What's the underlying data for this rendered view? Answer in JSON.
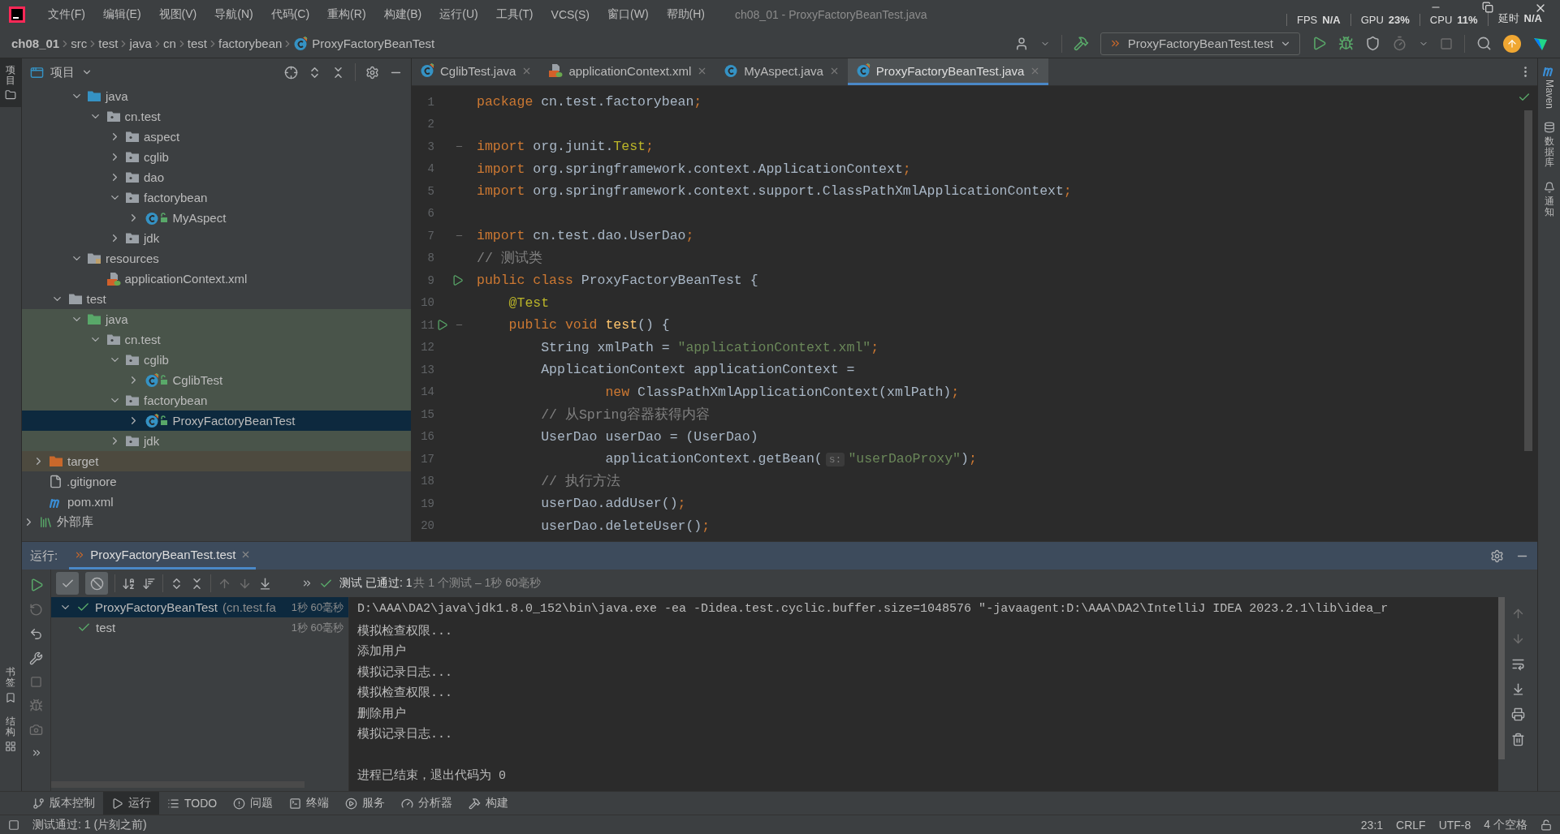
{
  "window": {
    "title": "ch08_01 - ProxyFactoryBeanTest.java"
  },
  "menu": [
    "文件(F)",
    "编辑(E)",
    "视图(V)",
    "导航(N)",
    "代码(C)",
    "重构(R)",
    "构建(B)",
    "运行(U)",
    "工具(T)",
    "VCS(S)",
    "窗口(W)",
    "帮助(H)"
  ],
  "monitor": [
    {
      "label": "FPS",
      "value": "N/A"
    },
    {
      "label": "GPU",
      "value": "23%"
    },
    {
      "label": "CPU",
      "value": "11%"
    },
    {
      "label": "延时",
      "value": "N/A"
    }
  ],
  "breadcrumbs": [
    {
      "label": "ch08_01",
      "kind": "project"
    },
    {
      "label": "src",
      "kind": "folder"
    },
    {
      "label": "test",
      "kind": "folder"
    },
    {
      "label": "java",
      "kind": "folder"
    },
    {
      "label": "cn",
      "kind": "folder"
    },
    {
      "label": "test",
      "kind": "folder"
    },
    {
      "label": "factorybean",
      "kind": "folder"
    },
    {
      "label": "ProxyFactoryBeanTest",
      "kind": "class"
    }
  ],
  "run_config": "ProxyFactoryBeanTest.test",
  "side_left": {
    "top": [
      {
        "label": "项目",
        "selected": true
      }
    ],
    "bottom": [
      {
        "label": "书签",
        "kind": "bookmarks"
      },
      {
        "label": "结构",
        "kind": "structure"
      }
    ]
  },
  "side_right": [
    {
      "label": "Maven",
      "kind": "maven"
    },
    {
      "label": "数据库",
      "kind": "database"
    },
    {
      "label": "通知",
      "kind": "notifications"
    }
  ],
  "project_panel": {
    "title": "项目",
    "tree": [
      {
        "children": [
          {
            "children": [
              {
                "children": [
                  {
                    "label": "java",
                    "kind": "source-root",
                    "expanded": true,
                    "selected": false,
                    "children": [
                      {
                        "label": "cn.test",
                        "kind": "package",
                        "expanded": true,
                        "selected": false,
                        "children": [
                          {
                            "label": "aspect",
                            "kind": "package",
                            "expanded": false,
                            "selected": false
                          },
                          {
                            "label": "cglib",
                            "kind": "package",
                            "expanded": false,
                            "selected": false
                          },
                          {
                            "label": "dao",
                            "kind": "package",
                            "expanded": false,
                            "selected": false
                          },
                          {
                            "label": "factorybean",
                            "kind": "package",
                            "expanded": true,
                            "selected": false,
                            "children": [
                              {
                                "label": "MyAspect",
                                "kind": "class",
                                "expanded": false,
                                "selected": false
                              }
                            ]
                          },
                          {
                            "label": "jdk",
                            "kind": "package",
                            "expanded": false,
                            "selected": false
                          }
                        ]
                      }
                    ]
                  },
                  {
                    "label": "resources",
                    "kind": "resources",
                    "expanded": true,
                    "selected": false,
                    "children": [
                      {
                        "label": "applicationContext.xml",
                        "kind": "xml",
                        "selected": false
                      }
                    ]
                  }
                ]
              },
              {
                "label": "test",
                "kind": "folder",
                "expanded": true,
                "selected": false,
                "children": [
                  {
                    "label": "java",
                    "kind": "test-root",
                    "expanded": true,
                    "selected": false,
                    "children": [
                      {
                        "label": "cn.test",
                        "kind": "package",
                        "expanded": true,
                        "selected": false,
                        "children": [
                          {
                            "label": "cglib",
                            "kind": "package",
                            "expanded": true,
                            "selected": false,
                            "children": [
                              {
                                "label": "CglibTest",
                                "kind": "test-class",
                                "expanded": false,
                                "selected": false
                              }
                            ]
                          },
                          {
                            "label": "factorybean",
                            "kind": "package",
                            "expanded": true,
                            "selected": false,
                            "children": [
                              {
                                "label": "ProxyFactoryBeanTest",
                                "kind": "test-class",
                                "expanded": false,
                                "selected": true
                              }
                            ]
                          },
                          {
                            "label": "jdk",
                            "kind": "package",
                            "expanded": false,
                            "selected": false
                          }
                        ]
                      }
                    ]
                  }
                ]
              }
            ]
          },
          {
            "label": "target",
            "kind": "excluded",
            "expanded": false,
            "selected": false
          },
          {
            "label": ".gitignore",
            "kind": "gitignore",
            "selected": false
          },
          {
            "label": "pom.xml",
            "kind": "maven",
            "selected": false
          }
        ]
      },
      {
        "label": "外部库",
        "kind": "library",
        "expanded": false,
        "selected": false
      }
    ]
  },
  "editor": {
    "tabs": [
      {
        "label": "CglibTest.java",
        "kind": "test-class",
        "selected": false
      },
      {
        "label": "applicationContext.xml",
        "kind": "xml",
        "selected": false
      },
      {
        "label": "MyAspect.java",
        "kind": "class",
        "selected": false
      },
      {
        "label": "ProxyFactoryBeanTest.java",
        "kind": "test-class",
        "selected": true
      }
    ],
    "lines": [
      {
        "number": "1",
        "tokens": [
          {
            "kind": "kw",
            "text": "package"
          },
          {
            "kind": "plain",
            "text": " cn.test.factorybean"
          },
          {
            "kind": "kw",
            "text": ";"
          }
        ]
      },
      {
        "number": "2"
      },
      {
        "number": "3",
        "kind": "fold",
        "tokens": [
          {
            "kind": "kw",
            "text": "import"
          },
          {
            "kind": "plain",
            "text": " org.junit."
          },
          {
            "kind": "ann",
            "text": "Test"
          },
          {
            "kind": "kw",
            "text": ";"
          }
        ]
      },
      {
        "number": "4",
        "tokens": [
          {
            "kind": "kw",
            "text": "import"
          },
          {
            "kind": "plain",
            "text": " org.springframework.context.ApplicationContext"
          },
          {
            "kind": "kw",
            "text": ";"
          }
        ]
      },
      {
        "number": "5",
        "tokens": [
          {
            "kind": "kw",
            "text": "import"
          },
          {
            "kind": "plain",
            "text": " org.springframework.context.support.ClassPathXmlApplicationContext"
          },
          {
            "kind": "kw",
            "text": ";"
          }
        ]
      },
      {
        "number": "6"
      },
      {
        "number": "7",
        "kind": "fold",
        "tokens": [
          {
            "kind": "kw",
            "text": "import"
          },
          {
            "kind": "plain",
            "text": " cn.test.dao.UserDao"
          },
          {
            "kind": "kw",
            "text": ";"
          }
        ]
      },
      {
        "number": "8",
        "tokens": [
          {
            "kind": "cmt",
            "text": "// 测试类"
          }
        ]
      },
      {
        "number": "9",
        "kind": "run",
        "tokens": [
          {
            "kind": "kw",
            "text": "public class"
          },
          {
            "kind": "plain",
            "text": " ProxyFactoryBeanTest {"
          }
        ]
      },
      {
        "number": "10",
        "tokens": [
          {
            "kind": "ann",
            "text": "    @Test"
          }
        ]
      },
      {
        "number": "11",
        "kind": "run-fold",
        "tokens": [
          {
            "kind": "kw",
            "text": "    public void"
          },
          {
            "kind": "fn",
            "text": " test"
          },
          {
            "kind": "plain",
            "text": "() {"
          }
        ]
      },
      {
        "number": "12",
        "tokens": [
          {
            "kind": "plain",
            "text": "        String xmlPath = "
          },
          {
            "kind": "str",
            "text": "\"applicationContext.xml\""
          },
          {
            "kind": "kw",
            "text": ";"
          }
        ]
      },
      {
        "number": "13",
        "tokens": [
          {
            "kind": "plain",
            "text": "        ApplicationContext applicationContext ="
          }
        ]
      },
      {
        "number": "14",
        "tokens": [
          {
            "kind": "kw",
            "text": "                new"
          },
          {
            "kind": "plain",
            "text": " ClassPathXmlApplicationContext(xmlPath)"
          },
          {
            "kind": "kw",
            "text": ";"
          }
        ]
      },
      {
        "number": "15",
        "tokens": [
          {
            "kind": "cmt",
            "text": "        // 从Spring容器获得内容"
          }
        ]
      },
      {
        "number": "16",
        "tokens": [
          {
            "kind": "plain",
            "text": "        UserDao userDao = (UserDao)"
          }
        ]
      },
      {
        "number": "17",
        "tokens": [
          {
            "kind": "plain",
            "text": "                applicationContext.getBean("
          },
          {
            "kind": "hint",
            "text": "s:"
          },
          {
            "kind": "str",
            "text": "\"userDaoProxy\""
          },
          {
            "kind": "plain",
            "text": ")"
          },
          {
            "kind": "kw",
            "text": ";"
          }
        ]
      },
      {
        "number": "18",
        "tokens": [
          {
            "kind": "cmt",
            "text": "        // 执行方法"
          }
        ]
      },
      {
        "number": "19",
        "tokens": [
          {
            "kind": "plain",
            "text": "        userDao.addUser()"
          },
          {
            "kind": "kw",
            "text": ";"
          }
        ]
      },
      {
        "number": "20",
        "tokens": [
          {
            "kind": "plain",
            "text": "        userDao.deleteUser()"
          },
          {
            "kind": "kw",
            "text": ";"
          }
        ]
      }
    ]
  },
  "run_panel": {
    "label": "运行:",
    "tabs": [
      {
        "label": "ProxyFactoryBeanTest.test",
        "selected": true
      }
    ],
    "toggles": [
      {
        "kind": "passed",
        "on": true
      },
      {
        "kind": "ignored",
        "on": true
      }
    ],
    "summary": {
      "status": "测试 已通过: 1",
      "detail": "共 1 个测试 – 1秒 60毫秒"
    },
    "results": [
      {
        "label": "ProxyFactoryBeanTest",
        "detail": "(cn.test.fa",
        "time": "1秒 60毫秒",
        "passed": true,
        "expanded": true,
        "selected": true,
        "children": [
          {
            "label": "test",
            "time": "1秒 60毫秒",
            "passed": true,
            "selected": false
          }
        ]
      }
    ],
    "console": {
      "lines": [
        {
          "text": "D:\\AAA\\DA2\\java\\jdk1.8.0_152\\bin\\java.exe -ea -Didea.test.cyclic.buffer.size=1048576 \"-javaagent:D:\\AAA\\DA2\\IntelliJ IDEA 2023.2.1\\lib\\idea_r"
        },
        {
          "text": "模拟检查权限..."
        },
        {
          "text": "添加用户"
        },
        {
          "text": "模拟记录日志..."
        },
        {
          "text": "模拟检查权限..."
        },
        {
          "text": "删除用户"
        },
        {
          "text": "模拟记录日志..."
        }
      ],
      "exit_message": "进程已结束，退出代码为 0"
    }
  },
  "tool_tabs": [
    {
      "label": "版本控制",
      "kind": "branch",
      "selected": false
    },
    {
      "label": "运行",
      "kind": "run",
      "selected": true
    },
    {
      "label": "TODO",
      "kind": "list",
      "selected": false
    },
    {
      "label": "问题",
      "kind": "problems",
      "selected": false
    },
    {
      "label": "终端",
      "kind": "terminal",
      "selected": false
    },
    {
      "label": "服务",
      "kind": "services",
      "selected": false
    },
    {
      "label": "分析器",
      "kind": "profiler",
      "selected": false
    },
    {
      "label": "构建",
      "kind": "build",
      "selected": false
    }
  ],
  "status": {
    "message": "测试通过: 1 (片刻之前)",
    "items": [
      "23:1",
      "CRLF",
      "UTF-8",
      "4 个空格"
    ]
  }
}
